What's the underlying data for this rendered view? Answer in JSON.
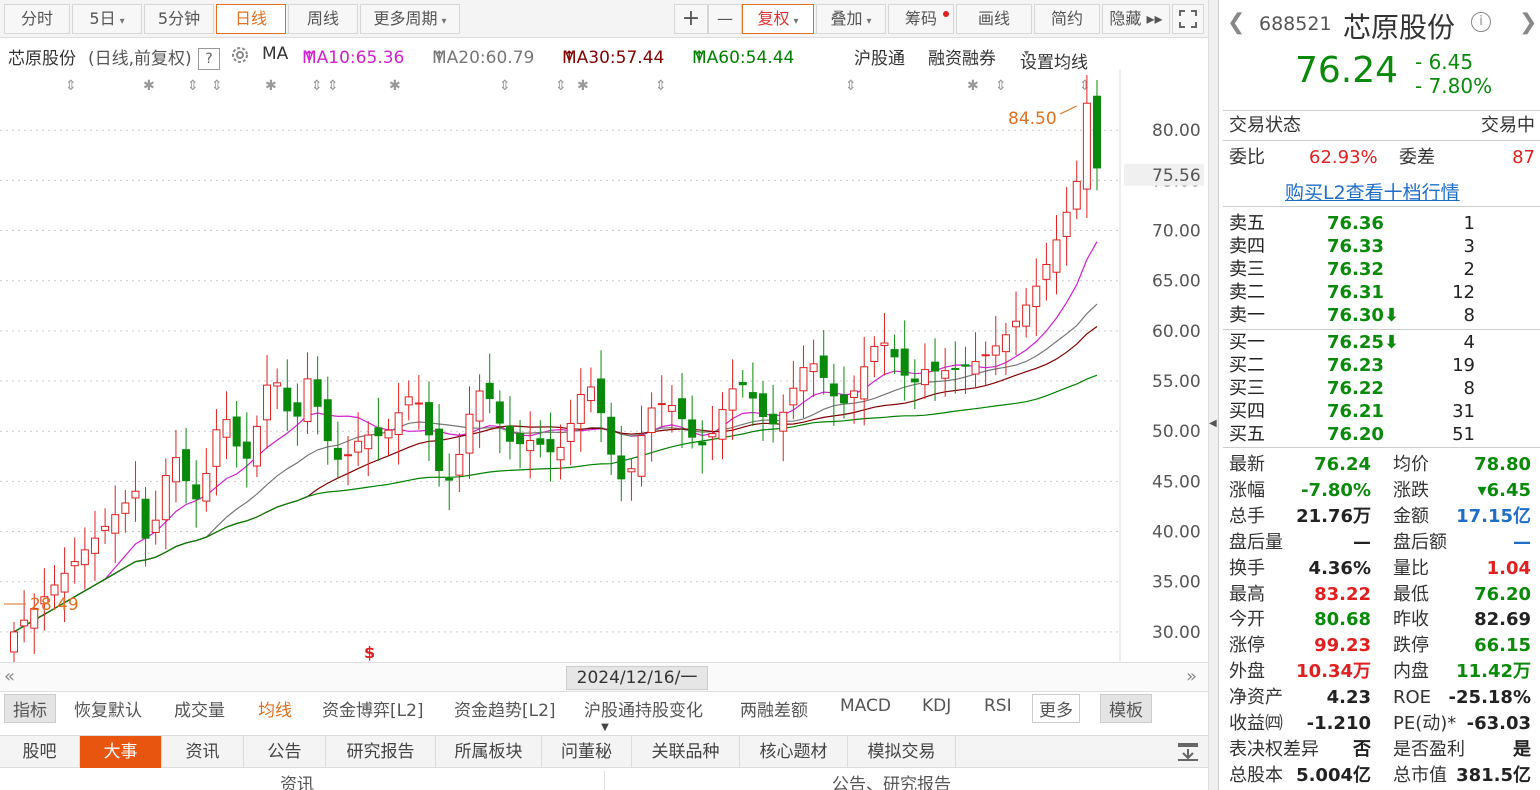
{
  "toolbar": {
    "tabs": [
      "分时",
      "5日",
      "5分钟",
      "日线",
      "周线",
      "更多周期"
    ],
    "active_tab": "日线",
    "tools": [
      "+",
      "—",
      "复权",
      "叠加",
      "筹码",
      "画线",
      "简约",
      "隐藏 ▸▸"
    ]
  },
  "ma_line": {
    "stock": "芯原股份",
    "mode": "(日线,前复权)",
    "help": "?",
    "ma_label": "MA",
    "ma10": "MA10:65.36",
    "ma20": "MA20:60.79",
    "ma30": "MA30:57.44",
    "ma60": "MA60:54.44",
    "links": [
      "沪股通",
      "融资融券",
      "设置均线"
    ]
  },
  "chart_data": {
    "type": "candlestick",
    "price_ticks": [
      "80.00",
      "75.00",
      "70.00",
      "65.00",
      "60.00",
      "55.00",
      "50.00",
      "45.00",
      "40.00",
      "35.00",
      "30.00"
    ],
    "ylim": [
      27,
      86
    ],
    "current_price_label": "75.56",
    "high_label": "84.50",
    "low_label": "28.49",
    "date_label": "2024/12/16/一",
    "colors": {
      "up": "#e02020",
      "down": "#0a8a0a",
      "ma10": "#d020d0",
      "ma20": "#777777",
      "ma30": "#800000",
      "ma60": "#008000"
    }
  },
  "indicator_tabs": [
    "指标",
    "恢复默认",
    "成交量",
    "均线",
    "资金博弈[L2]",
    "资金趋势[L2]",
    "沪股通持股变化",
    "两融差额",
    "MACD",
    "KDJ",
    "RSI",
    "更多",
    "模板"
  ],
  "bottom_nav": [
    "股吧",
    "大事",
    "资讯",
    "公告",
    "研究报告",
    "所属板块",
    "问董秘",
    "关联品种",
    "核心题材",
    "模拟交易"
  ],
  "bottom_nav_active": "大事",
  "bottom_sub": [
    "资讯",
    "公告、研究报告"
  ],
  "quote": {
    "code": "688521",
    "name": "芯原股份",
    "price": "76.24",
    "change": "- 6.45",
    "change_pct": "- 7.80%",
    "status_label": "交易状态",
    "status_value": "交易中",
    "weibi_label": "委比",
    "weibi_value": "62.93%",
    "weicha_label": "委差",
    "weicha_value": "87",
    "l2_link": "购买L2查看十档行情",
    "asks": [
      {
        "label": "卖五",
        "price": "76.36",
        "vol": "1"
      },
      {
        "label": "卖四",
        "price": "76.33",
        "vol": "3"
      },
      {
        "label": "卖三",
        "price": "76.32",
        "vol": "2"
      },
      {
        "label": "卖二",
        "price": "76.31",
        "vol": "12"
      },
      {
        "label": "卖一",
        "price": "76.30⬇",
        "vol": "8"
      }
    ],
    "bids": [
      {
        "label": "买一",
        "price": "76.25⬇",
        "vol": "4"
      },
      {
        "label": "买二",
        "price": "76.23",
        "vol": "19"
      },
      {
        "label": "买三",
        "price": "76.22",
        "vol": "8"
      },
      {
        "label": "买四",
        "price": "76.21",
        "vol": "31"
      },
      {
        "label": "买五",
        "price": "76.20",
        "vol": "51"
      }
    ],
    "stats": [
      {
        "l1": "最新",
        "v1": "76.24",
        "c1": "green",
        "l2": "均价",
        "v2": "78.80",
        "c2": "green"
      },
      {
        "l1": "涨幅",
        "v1": "-7.80%",
        "c1": "green",
        "l2": "涨跌",
        "v2": "▾6.45",
        "c2": "green"
      },
      {
        "l1": "总手",
        "v1": "21.76万",
        "c1": "dark",
        "l2": "金额",
        "v2": "17.15亿",
        "c2": "blue"
      },
      {
        "l1": "盘后量",
        "v1": "—",
        "c1": "dark",
        "l2": "盘后额",
        "v2": "—",
        "c2": "blue"
      },
      {
        "l1": "换手",
        "v1": "4.36%",
        "c1": "dark",
        "l2": "量比",
        "v2": "1.04",
        "c2": "red"
      },
      {
        "l1": "最高",
        "v1": "83.22",
        "c1": "red",
        "l2": "最低",
        "v2": "76.20",
        "c2": "green"
      },
      {
        "l1": "今开",
        "v1": "80.68",
        "c1": "green",
        "l2": "昨收",
        "v2": "82.69",
        "c2": "dark"
      },
      {
        "l1": "涨停",
        "v1": "99.23",
        "c1": "red",
        "l2": "跌停",
        "v2": "66.15",
        "c2": "green"
      },
      {
        "l1": "外盘",
        "v1": "10.34万",
        "c1": "red",
        "l2": "内盘",
        "v2": "11.42万",
        "c2": "green"
      },
      {
        "l1": "净资产",
        "v1": "4.23",
        "c1": "dark",
        "l2": "ROE",
        "v2": "-25.18%",
        "c2": "dark"
      },
      {
        "l1": "收益㈣",
        "v1": "-1.210",
        "c1": "dark",
        "l2": "PE(动)*",
        "v2": "-63.03",
        "c2": "dark"
      },
      {
        "l1": "表决权差异",
        "v1": "否",
        "c1": "dark",
        "l2": "是否盈利",
        "v2": "是",
        "c2": "dark"
      },
      {
        "l1": "总股本",
        "v1": "5.004亿",
        "c1": "dark",
        "l2": "总市值",
        "v2": "381.5亿",
        "c2": "dark"
      }
    ]
  }
}
